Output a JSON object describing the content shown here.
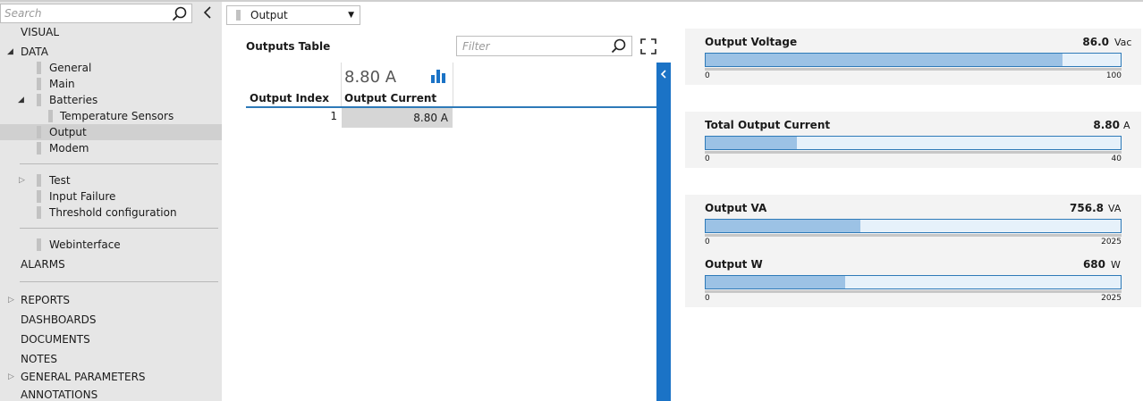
{
  "sidebar": {
    "search_placeholder": "Search",
    "items": [
      {
        "label": "VISUAL"
      },
      {
        "label": "DATA"
      },
      {
        "label": "General"
      },
      {
        "label": "Main"
      },
      {
        "label": "Batteries"
      },
      {
        "label": "Temperature Sensors"
      },
      {
        "label": "Output"
      },
      {
        "label": "Modem"
      },
      {
        "label": "Test"
      },
      {
        "label": "Input Failure"
      },
      {
        "label": "Threshold configuration"
      },
      {
        "label": "Webinterface"
      },
      {
        "label": "ALARMS"
      },
      {
        "label": "REPORTS"
      },
      {
        "label": "DASHBOARDS"
      },
      {
        "label": "DOCUMENTS"
      },
      {
        "label": "NOTES"
      },
      {
        "label": "GENERAL PARAMETERS"
      },
      {
        "label": "ANNOTATIONS"
      }
    ]
  },
  "toolbar": {
    "dropdown_value": "Output"
  },
  "outputs_table": {
    "title": "Outputs Table",
    "filter_placeholder": "Filter",
    "summary_value": "8.80 A",
    "columns": [
      "Output Index",
      "Output Current"
    ],
    "rows": [
      {
        "index": "1",
        "current": "8.80 A"
      }
    ]
  },
  "gauges": [
    {
      "title": "Output Voltage",
      "value": "86.0",
      "unit": "Vac",
      "min": "0",
      "max": "100",
      "fraction": 0.86
    },
    {
      "title": "Total Output Current",
      "value": "8.80",
      "unit": "A",
      "min": "0",
      "max": "40",
      "fraction": 0.22
    },
    {
      "title": "Output VA",
      "value": "756.8",
      "unit": "VA",
      "min": "0",
      "max": "2025",
      "fraction": 0.3737
    },
    {
      "title": "Output W",
      "value": "680",
      "unit": "W",
      "min": "0",
      "max": "2025",
      "fraction": 0.3358
    }
  ],
  "colors": {
    "accent": "#1b73c6",
    "gauge_fill": "#9cc2e5",
    "gauge_track": "#e6f1fa",
    "sidebar_bg": "#e6e6e6"
  }
}
